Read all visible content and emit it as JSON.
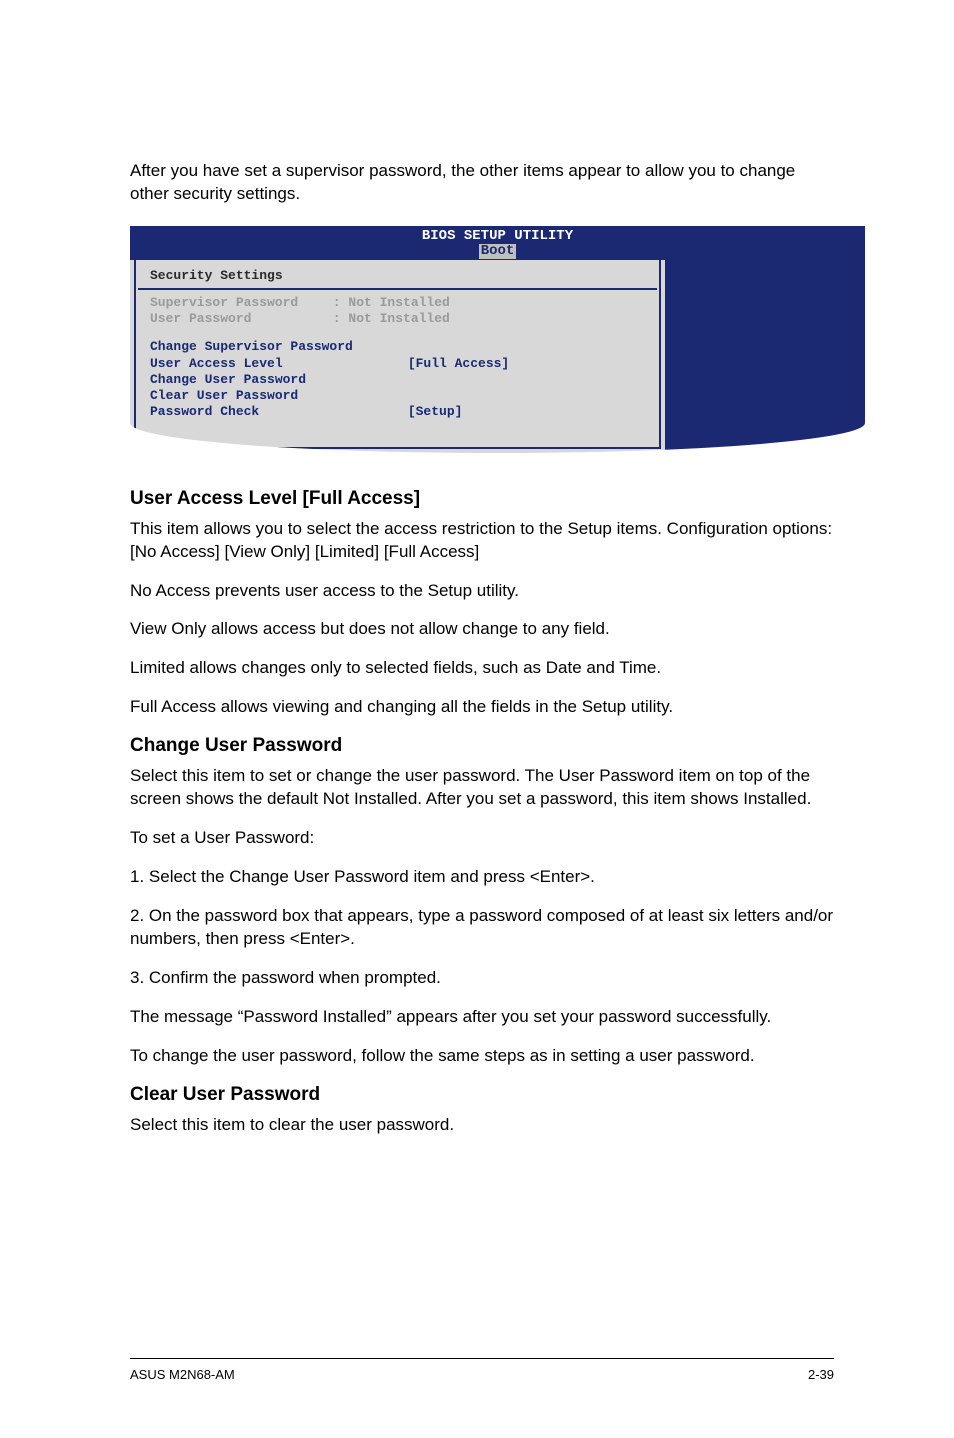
{
  "intro": "After you have set a supervisor password, the other items appear to allow you to change other security settings.",
  "bios": {
    "header_title": "BIOS SETUP UTILITY",
    "header_tab": "Boot",
    "security_title": "Security Settings",
    "supervisor_label": "Supervisor Password",
    "supervisor_value": ": Not Installed",
    "user_label": "User Password",
    "user_value": ": Not Installed",
    "change_supervisor": "Change Supervisor Password",
    "user_access_level_label": "User Access Level",
    "user_access_level_value": "[Full Access]",
    "change_user": "Change User Password",
    "clear_user": "Clear User Password",
    "password_check_label": "Password Check",
    "password_check_value": "[Setup]"
  },
  "section1": {
    "heading": "User Access Level [Full Access]",
    "para1": "This item allows you to select the access restriction to the Setup items. Configuration options: [No Access] [View Only] [Limited] [Full Access]",
    "para2": "No Access prevents user access to the Setup utility.",
    "para3": "View Only allows access but does not allow change to any field.",
    "para4": "Limited allows changes only to selected fields, such as Date and Time.",
    "para5": "Full Access allows viewing and changing all the fields in the Setup utility."
  },
  "section2": {
    "heading": "Change User Password",
    "para1": "Select this item to set or change the user password. The User Password item on top of the screen shows the default Not Installed. After you set a password, this item shows Installed.",
    "para2": "To set a User Password:",
    "step1": "1. Select the Change User Password item and press <Enter>.",
    "step2": "2. On the password box that appears, type a password composed of at least six letters and/or numbers, then press <Enter>.",
    "step3": "3. Confirm the password when prompted.",
    "para3": "The message “Password Installed” appears after you set your password successfully.",
    "para4": "To change the user password, follow the same steps as in setting a user password."
  },
  "section3": {
    "heading": "Clear User Password",
    "para1": "Select this item to clear the user password."
  },
  "footer": {
    "left": "ASUS M2N68-AM",
    "right": "2-39"
  }
}
